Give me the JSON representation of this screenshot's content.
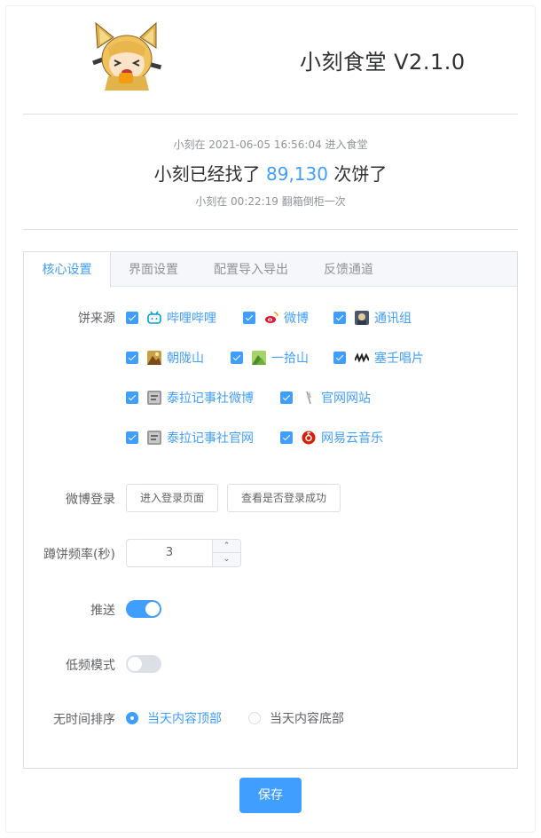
{
  "header": {
    "title": "小刻食堂 V2.1.0"
  },
  "stats": {
    "enter_time_text": "小刻在 2021-06-05 16:56:04 进入食堂",
    "counter_prefix": "小刻已经找了 ",
    "counter_value": "89,130",
    "counter_suffix": " 次饼了",
    "flip_time_text": "小刻在 00:22:19 翻箱倒柜一次"
  },
  "tabs": [
    {
      "label": "核心设置",
      "active": true
    },
    {
      "label": "界面设置",
      "active": false
    },
    {
      "label": "配置导入导出",
      "active": false
    },
    {
      "label": "反馈通道",
      "active": false
    }
  ],
  "form": {
    "sources_label": "饼来源",
    "sources": [
      {
        "label": "哔哩哔哩",
        "checked": true,
        "icon": "bilibili-icon",
        "color": "#00a1d6"
      },
      {
        "label": "微博",
        "checked": true,
        "icon": "weibo-icon",
        "color": "#e6162d"
      },
      {
        "label": "通讯组",
        "checked": true,
        "icon": "telegram-group-icon",
        "color": "#4a5a6a"
      },
      {
        "label": "朝陇山",
        "checked": true,
        "icon": "chaolongshan-icon",
        "color": "#c9a04a"
      },
      {
        "label": "一拾山",
        "checked": true,
        "icon": "yishishan-icon",
        "color": "#6fae3a"
      },
      {
        "label": "塞壬唱片",
        "checked": true,
        "icon": "monster-siren-icon",
        "color": "#222222"
      },
      {
        "label": "泰拉记事社微博",
        "checked": true,
        "icon": "terra-historicus-weibo-icon",
        "color": "#8a8a8a"
      },
      {
        "label": "官网网站",
        "checked": true,
        "icon": "official-site-icon",
        "color": "#9a9a9a"
      },
      {
        "label": "泰拉记事社官网",
        "checked": true,
        "icon": "terra-historicus-site-icon",
        "color": "#8a8a8a"
      },
      {
        "label": "网易云音乐",
        "checked": true,
        "icon": "netease-music-icon",
        "color": "#d81e06"
      }
    ],
    "weibo_login_label": "微博登录",
    "login_page_button": "进入登录页面",
    "check_login_button": "查看是否登录成功",
    "frequency_label": "蹲饼频率(秒)",
    "frequency_value": "3",
    "push_label": "推送",
    "push_enabled": true,
    "low_freq_label": "低频模式",
    "low_freq_enabled": false,
    "sort_label": "无时间排序",
    "sort_options": [
      {
        "label": "当天内容顶部",
        "checked": true
      },
      {
        "label": "当天内容底部",
        "checked": false
      }
    ]
  },
  "save_button": "保存",
  "colors": {
    "accent": "#409eff",
    "border": "#dcdfe6",
    "text": "#606266",
    "muted": "#909399"
  }
}
